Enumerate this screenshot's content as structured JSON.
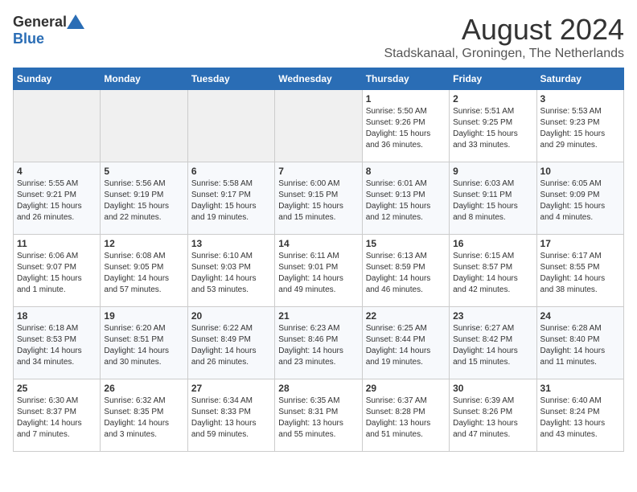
{
  "header": {
    "logo_general": "General",
    "logo_blue": "Blue",
    "month_title": "August 2024",
    "location": "Stadskanaal, Groningen, The Netherlands"
  },
  "days_of_week": [
    "Sunday",
    "Monday",
    "Tuesday",
    "Wednesday",
    "Thursday",
    "Friday",
    "Saturday"
  ],
  "weeks": [
    [
      {
        "day": "",
        "info": ""
      },
      {
        "day": "",
        "info": ""
      },
      {
        "day": "",
        "info": ""
      },
      {
        "day": "",
        "info": ""
      },
      {
        "day": "1",
        "info": "Sunrise: 5:50 AM\nSunset: 9:26 PM\nDaylight: 15 hours\nand 36 minutes."
      },
      {
        "day": "2",
        "info": "Sunrise: 5:51 AM\nSunset: 9:25 PM\nDaylight: 15 hours\nand 33 minutes."
      },
      {
        "day": "3",
        "info": "Sunrise: 5:53 AM\nSunset: 9:23 PM\nDaylight: 15 hours\nand 29 minutes."
      }
    ],
    [
      {
        "day": "4",
        "info": "Sunrise: 5:55 AM\nSunset: 9:21 PM\nDaylight: 15 hours\nand 26 minutes."
      },
      {
        "day": "5",
        "info": "Sunrise: 5:56 AM\nSunset: 9:19 PM\nDaylight: 15 hours\nand 22 minutes."
      },
      {
        "day": "6",
        "info": "Sunrise: 5:58 AM\nSunset: 9:17 PM\nDaylight: 15 hours\nand 19 minutes."
      },
      {
        "day": "7",
        "info": "Sunrise: 6:00 AM\nSunset: 9:15 PM\nDaylight: 15 hours\nand 15 minutes."
      },
      {
        "day": "8",
        "info": "Sunrise: 6:01 AM\nSunset: 9:13 PM\nDaylight: 15 hours\nand 12 minutes."
      },
      {
        "day": "9",
        "info": "Sunrise: 6:03 AM\nSunset: 9:11 PM\nDaylight: 15 hours\nand 8 minutes."
      },
      {
        "day": "10",
        "info": "Sunrise: 6:05 AM\nSunset: 9:09 PM\nDaylight: 15 hours\nand 4 minutes."
      }
    ],
    [
      {
        "day": "11",
        "info": "Sunrise: 6:06 AM\nSunset: 9:07 PM\nDaylight: 15 hours\nand 1 minute."
      },
      {
        "day": "12",
        "info": "Sunrise: 6:08 AM\nSunset: 9:05 PM\nDaylight: 14 hours\nand 57 minutes."
      },
      {
        "day": "13",
        "info": "Sunrise: 6:10 AM\nSunset: 9:03 PM\nDaylight: 14 hours\nand 53 minutes."
      },
      {
        "day": "14",
        "info": "Sunrise: 6:11 AM\nSunset: 9:01 PM\nDaylight: 14 hours\nand 49 minutes."
      },
      {
        "day": "15",
        "info": "Sunrise: 6:13 AM\nSunset: 8:59 PM\nDaylight: 14 hours\nand 46 minutes."
      },
      {
        "day": "16",
        "info": "Sunrise: 6:15 AM\nSunset: 8:57 PM\nDaylight: 14 hours\nand 42 minutes."
      },
      {
        "day": "17",
        "info": "Sunrise: 6:17 AM\nSunset: 8:55 PM\nDaylight: 14 hours\nand 38 minutes."
      }
    ],
    [
      {
        "day": "18",
        "info": "Sunrise: 6:18 AM\nSunset: 8:53 PM\nDaylight: 14 hours\nand 34 minutes."
      },
      {
        "day": "19",
        "info": "Sunrise: 6:20 AM\nSunset: 8:51 PM\nDaylight: 14 hours\nand 30 minutes."
      },
      {
        "day": "20",
        "info": "Sunrise: 6:22 AM\nSunset: 8:49 PM\nDaylight: 14 hours\nand 26 minutes."
      },
      {
        "day": "21",
        "info": "Sunrise: 6:23 AM\nSunset: 8:46 PM\nDaylight: 14 hours\nand 23 minutes."
      },
      {
        "day": "22",
        "info": "Sunrise: 6:25 AM\nSunset: 8:44 PM\nDaylight: 14 hours\nand 19 minutes."
      },
      {
        "day": "23",
        "info": "Sunrise: 6:27 AM\nSunset: 8:42 PM\nDaylight: 14 hours\nand 15 minutes."
      },
      {
        "day": "24",
        "info": "Sunrise: 6:28 AM\nSunset: 8:40 PM\nDaylight: 14 hours\nand 11 minutes."
      }
    ],
    [
      {
        "day": "25",
        "info": "Sunrise: 6:30 AM\nSunset: 8:37 PM\nDaylight: 14 hours\nand 7 minutes."
      },
      {
        "day": "26",
        "info": "Sunrise: 6:32 AM\nSunset: 8:35 PM\nDaylight: 14 hours\nand 3 minutes."
      },
      {
        "day": "27",
        "info": "Sunrise: 6:34 AM\nSunset: 8:33 PM\nDaylight: 13 hours\nand 59 minutes."
      },
      {
        "day": "28",
        "info": "Sunrise: 6:35 AM\nSunset: 8:31 PM\nDaylight: 13 hours\nand 55 minutes."
      },
      {
        "day": "29",
        "info": "Sunrise: 6:37 AM\nSunset: 8:28 PM\nDaylight: 13 hours\nand 51 minutes."
      },
      {
        "day": "30",
        "info": "Sunrise: 6:39 AM\nSunset: 8:26 PM\nDaylight: 13 hours\nand 47 minutes."
      },
      {
        "day": "31",
        "info": "Sunrise: 6:40 AM\nSunset: 8:24 PM\nDaylight: 13 hours\nand 43 minutes."
      }
    ]
  ]
}
